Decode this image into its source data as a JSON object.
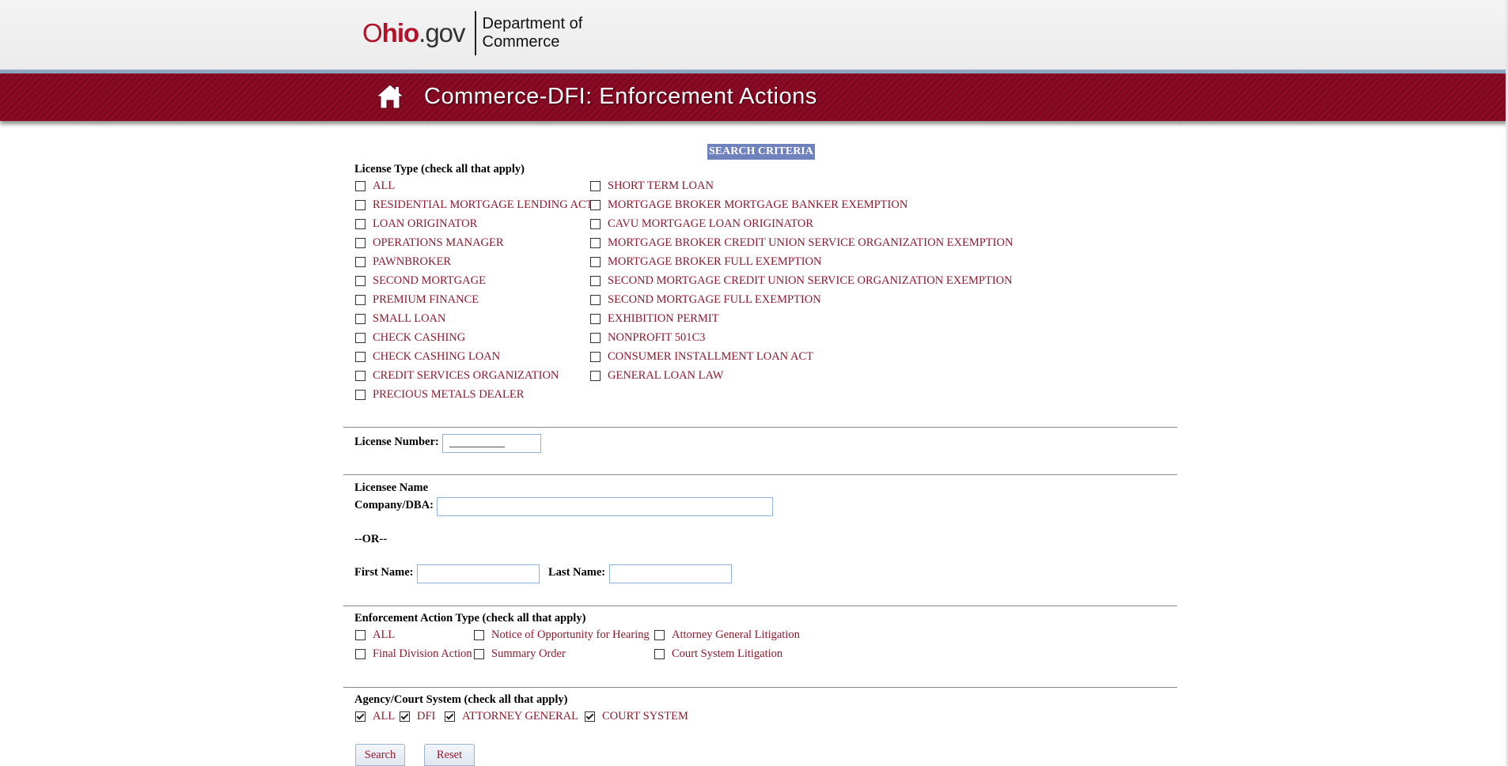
{
  "header": {
    "logo": {
      "ohio_o": "O",
      "ohio_hio": "hio",
      "ohio_gov": ".gov",
      "dept_line1": "Department of",
      "dept_line2": "Commerce"
    },
    "title": "Commerce-DFI: Enforcement Actions",
    "home_icon": "home-icon"
  },
  "search_heading": "SEARCH CRITERIA",
  "license_type": {
    "label": "License Type (check all that apply)",
    "col1": [
      "ALL",
      "RESIDENTIAL MORTGAGE LENDING ACT",
      "LOAN ORIGINATOR",
      "OPERATIONS MANAGER",
      "PAWNBROKER",
      "SECOND MORTGAGE",
      "PREMIUM FINANCE",
      "SMALL LOAN",
      "CHECK CASHING",
      "CHECK CASHING LOAN",
      "CREDIT SERVICES ORGANIZATION",
      "PRECIOUS METALS DEALER"
    ],
    "col2": [
      "SHORT TERM LOAN",
      "MORTGAGE BROKER MORTGAGE BANKER EXEMPTION",
      "CAVU MORTGAGE LOAN ORIGINATOR",
      "MORTGAGE BROKER CREDIT UNION SERVICE ORGANIZATION EXEMPTION",
      "MORTGAGE BROKER FULL EXEMPTION",
      "SECOND MORTGAGE CREDIT UNION SERVICE ORGANIZATION EXEMPTION",
      "SECOND MORTGAGE FULL EXEMPTION",
      "EXHIBITION PERMIT",
      "NONPROFIT 501C3",
      "CONSUMER INSTALLMENT LOAN ACT",
      "GENERAL LOAN LAW"
    ]
  },
  "license_number": {
    "label": "License Number:",
    "value": "__________"
  },
  "licensee": {
    "heading": "Licensee Name",
    "company_label": "Company/DBA:",
    "company_value": "",
    "or_text": "--OR--",
    "first_label": "First Name:",
    "first_value": "",
    "last_label": "Last Name:",
    "last_value": ""
  },
  "action_type": {
    "label": "Enforcement Action Type (check all that apply)",
    "options": [
      "ALL",
      "Final Division Action",
      "Notice of Opportunity for Hearing",
      "Summary Order",
      "Attorney General Litigation",
      "Court System Litigation"
    ]
  },
  "agency": {
    "label": "Agency/Court System (check all that apply)",
    "options": [
      {
        "label": "ALL",
        "checked": true
      },
      {
        "label": "DFI",
        "checked": true
      },
      {
        "label": "ATTORNEY GENERAL",
        "checked": true
      },
      {
        "label": "COURT SYSTEM",
        "checked": true
      }
    ]
  },
  "buttons": {
    "search": "Search",
    "reset": "Reset"
  },
  "colors": {
    "brand_red": "#8c0c26",
    "link_red": "#8b1a2f",
    "heading_bg": "#7082bd"
  }
}
